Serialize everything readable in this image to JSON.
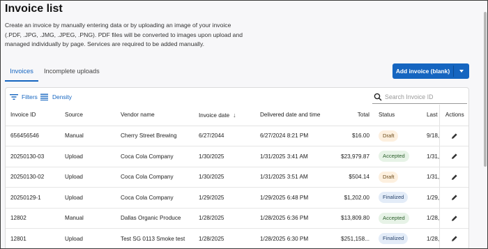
{
  "page": {
    "title": "Invoice list",
    "description": "Create an invoice by manually entering data or by uploading an image of your invoice (.PDF, .JPG, .JMG, .JPEG, .PNG). PDF files will be converted to images upon upload and managed individually by page. Services are required to be added manually."
  },
  "tabs": [
    {
      "label": "Invoices",
      "active": true
    },
    {
      "label": "Incomplete uploads",
      "active": false
    }
  ],
  "add_button": {
    "label": "Add invoice (blank)",
    "color": "#1565c0"
  },
  "toolbar": {
    "filters_label": "Filters",
    "density_label": "Density"
  },
  "search": {
    "placeholder": "Search Invoice ID",
    "value": ""
  },
  "table": {
    "columns": [
      "Invoice ID",
      "Source",
      "Vendor name",
      "Invoice date",
      "Delivered date and time",
      "Total",
      "Status",
      "Last",
      "Actions"
    ],
    "sorted_column": "Invoice date",
    "sort_direction": "descending",
    "rows": [
      {
        "invoice_id": "656456546",
        "source": "Manual",
        "vendor": "Cherry Street Brewing",
        "invoice_date": "6/27/2044",
        "delivered": "6/27/2024 8:21 PM",
        "total": "$16.00",
        "status": "Draft",
        "last": "9/18,"
      },
      {
        "invoice_id": "20250130-03",
        "source": "Upload",
        "vendor": "Coca Cola Company",
        "invoice_date": "1/30/2025",
        "delivered": "1/31/2025 3:41 AM",
        "total": "$23,979.87",
        "status": "Accepted",
        "last": "1/31,"
      },
      {
        "invoice_id": "20250130-02",
        "source": "Upload",
        "vendor": "Coca Cola Company",
        "invoice_date": "1/30/2025",
        "delivered": "1/31/2025 3:51 AM",
        "total": "$504.14",
        "status": "Draft",
        "last": "1/31,"
      },
      {
        "invoice_id": "20250129-1",
        "source": "Upload",
        "vendor": "Coca Cola Company",
        "invoice_date": "1/29/2025",
        "delivered": "1/29/2025 6:48 PM",
        "total": "$1,202.00",
        "status": "Finalized",
        "last": "1/29,"
      },
      {
        "invoice_id": "12802",
        "source": "Manual",
        "vendor": "Dallas Organic Produce",
        "invoice_date": "1/28/2025",
        "delivered": "1/28/2025 6:36 PM",
        "total": "$13,809.80",
        "status": "Accepted",
        "last": "1/28,"
      },
      {
        "invoice_id": "12801",
        "source": "Upload",
        "vendor": "Test SG 0113 Smoke test",
        "invoice_date": "1/28/2025",
        "delivered": "1/28/2025 6:30 PM",
        "total": "$251,158...",
        "status": "Finalized",
        "last": "1/28,"
      }
    ]
  },
  "icons": {
    "filters": "filter-icon",
    "density": "density-icon",
    "search": "search-icon",
    "sort": "arrow-down-icon",
    "edit": "pencil-icon",
    "dropdown": "chevron-down-icon"
  },
  "colors": {
    "accent": "#1565c0",
    "draft_bg": "#fdf0df",
    "accepted_bg": "#e7f3e7",
    "finalized_bg": "#e3ecf8"
  }
}
